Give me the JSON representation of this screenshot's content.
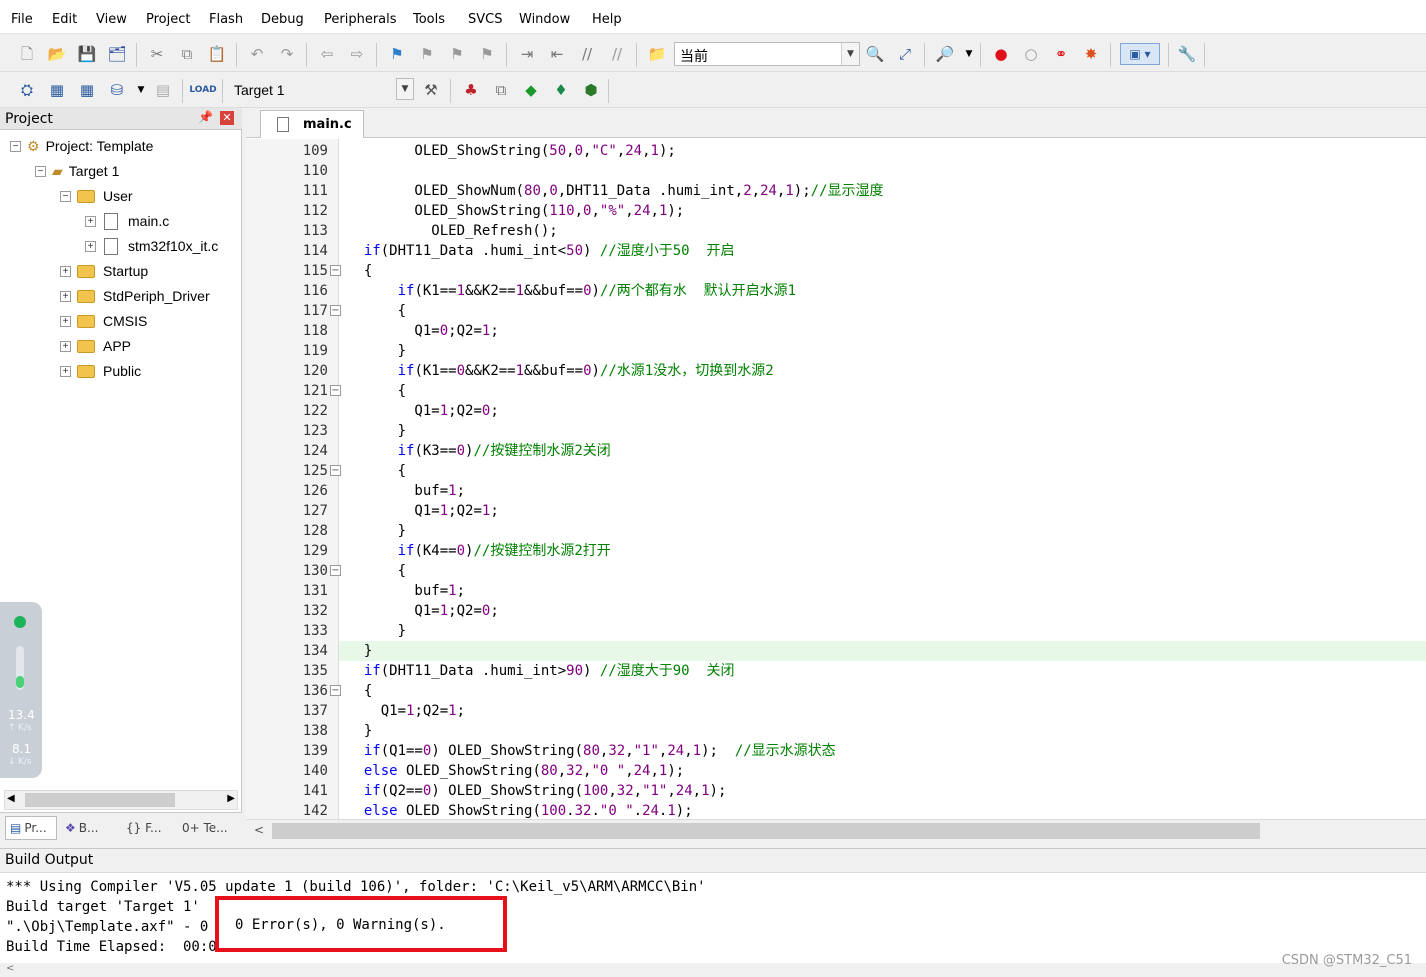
{
  "menu": [
    "File",
    "Edit",
    "View",
    "Project",
    "Flash",
    "Debug",
    "Peripherals",
    "Tools",
    "SVCS",
    "Window",
    "Help"
  ],
  "toolbar1": {
    "find_value": "当前"
  },
  "toolbar2": {
    "target_value": "Target 1"
  },
  "project_panel": {
    "title": "Project",
    "tree": [
      {
        "label": "Project: Template",
        "level": 0,
        "type": "project",
        "expanded": true
      },
      {
        "label": "Target 1",
        "level": 1,
        "type": "target",
        "expanded": true
      },
      {
        "label": "User",
        "level": 2,
        "type": "folder",
        "expanded": true
      },
      {
        "label": "main.c",
        "level": 3,
        "type": "file"
      },
      {
        "label": "stm32f10x_it.c",
        "level": 3,
        "type": "file"
      },
      {
        "label": "Startup",
        "level": 2,
        "type": "folder"
      },
      {
        "label": "StdPeriph_Driver",
        "level": 2,
        "type": "folder"
      },
      {
        "label": "CMSIS",
        "level": 2,
        "type": "folder"
      },
      {
        "label": "APP",
        "level": 2,
        "type": "folder"
      },
      {
        "label": "Public",
        "level": 2,
        "type": "folder"
      }
    ],
    "bottom_tabs": [
      "Pr...",
      "B...",
      "{} F...",
      "0+ Te..."
    ]
  },
  "editor": {
    "tab_label": "main.c",
    "current_line": 134,
    "lines": [
      {
        "n": "109",
        "text": "        OLED_ShowString(50,0,\"C\",24,1);"
      },
      {
        "n": "110",
        "text": ""
      },
      {
        "n": "111",
        "text": "        OLED_ShowNum(80,0,DHT11_Data .humi_int,2,24,1);//显示湿度"
      },
      {
        "n": "112",
        "text": "        OLED_ShowString(110,0,\"%\",24,1);"
      },
      {
        "n": "113",
        "text": "          OLED_Refresh();"
      },
      {
        "n": "114",
        "text": "  if(DHT11_Data .humi_int<50) //湿度小于50  开启"
      },
      {
        "n": "115",
        "text": "  {"
      },
      {
        "n": "116",
        "text": "      if(K1==1&&K2==1&&buf==0)//两个都有水  默认开启水源1"
      },
      {
        "n": "117",
        "text": "      {"
      },
      {
        "n": "118",
        "text": "        Q1=0;Q2=1;"
      },
      {
        "n": "119",
        "text": "      }"
      },
      {
        "n": "120",
        "text": "      if(K1==0&&K2==1&&buf==0)//水源1没水，切换到水源2"
      },
      {
        "n": "121",
        "text": "      {"
      },
      {
        "n": "122",
        "text": "        Q1=1;Q2=0;"
      },
      {
        "n": "123",
        "text": "      }"
      },
      {
        "n": "124",
        "text": "      if(K3==0)//按键控制水源2关闭"
      },
      {
        "n": "125",
        "text": "      {"
      },
      {
        "n": "126",
        "text": "        buf=1;"
      },
      {
        "n": "127",
        "text": "        Q1=1;Q2=1;"
      },
      {
        "n": "128",
        "text": "      }"
      },
      {
        "n": "129",
        "text": "      if(K4==0)//按键控制水源2打开"
      },
      {
        "n": "130",
        "text": "      {"
      },
      {
        "n": "131",
        "text": "        buf=1;"
      },
      {
        "n": "132",
        "text": "        Q1=1;Q2=0;"
      },
      {
        "n": "133",
        "text": "      }"
      },
      {
        "n": "134",
        "text": "  }"
      },
      {
        "n": "135",
        "text": "  if(DHT11_Data .humi_int>90) //湿度大于90  关闭"
      },
      {
        "n": "136",
        "text": "  {"
      },
      {
        "n": "137",
        "text": "    Q1=1;Q2=1;"
      },
      {
        "n": "138",
        "text": "  }"
      },
      {
        "n": "139",
        "text": "  if(Q1==0) OLED_ShowString(80,32,\"1\",24,1);  //显示水源状态"
      },
      {
        "n": "140",
        "text": "  else OLED_ShowString(80,32,\"0 \",24,1);"
      },
      {
        "n": "141",
        "text": "  if(Q2==0) OLED_ShowString(100,32,\"1\",24,1);"
      },
      {
        "n": "142",
        "text": "  else OLED ShowString(100.32.\"0 \".24.1);"
      }
    ]
  },
  "build_output": {
    "title": "Build Output",
    "lines": [
      "*** Using Compiler 'V5.05 update 1 (build 106)', folder: 'C:\\Keil_v5\\ARM\\ARMCC\\Bin'",
      "Build target 'Target 1'",
      "\".\\Obj\\Template.axf\" - 0 Error(s), 0 Warning(s).",
      "Build Time Elapsed:  00:00:00"
    ],
    "highlight_text": "0 Error(s), 0 Warning(s)."
  },
  "network_widget": {
    "upload_value": "13.4",
    "upload_unit": "K/s",
    "download_value": "8.1",
    "download_unit": "K/s"
  },
  "watermark": "CSDN @STM32_C51",
  "colors": {
    "keyword": "#0000ff",
    "number": "#800080",
    "comment": "#008000",
    "highlight_box": "#e8101c",
    "current_line": "#e8f8e8"
  }
}
